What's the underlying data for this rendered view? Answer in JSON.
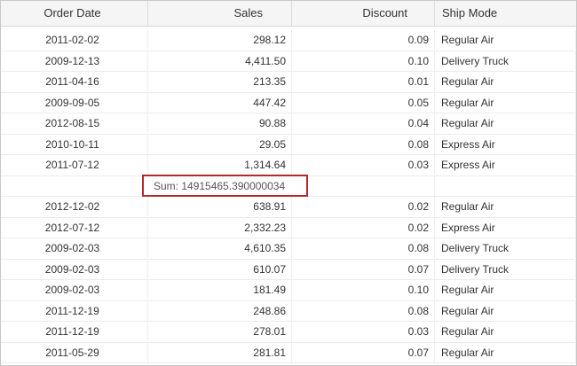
{
  "columns": [
    "Order Date",
    "Sales",
    "Discount",
    "Ship Mode"
  ],
  "rows_top": [
    {
      "date": "2011-02-02",
      "sales": "298.12",
      "discount": "0.09",
      "ship": "Regular Air"
    },
    {
      "date": "2009-12-13",
      "sales": "4,411.50",
      "discount": "0.10",
      "ship": "Delivery Truck"
    },
    {
      "date": "2011-04-16",
      "sales": "213.35",
      "discount": "0.01",
      "ship": "Regular Air"
    },
    {
      "date": "2009-09-05",
      "sales": "447.42",
      "discount": "0.05",
      "ship": "Regular Air"
    },
    {
      "date": "2012-08-15",
      "sales": "90.88",
      "discount": "0.04",
      "ship": "Regular Air"
    },
    {
      "date": "2010-10-11",
      "sales": "29.05",
      "discount": "0.08",
      "ship": "Express Air"
    },
    {
      "date": "2011-07-12",
      "sales": "1,314.64",
      "discount": "0.03",
      "ship": "Express Air"
    }
  ],
  "sum_label": "Sum: 14915465.390000034",
  "rows_bottom": [
    {
      "date": "2012-12-02",
      "sales": "638.91",
      "discount": "0.02",
      "ship": "Regular Air"
    },
    {
      "date": "2012-07-12",
      "sales": "2,332.23",
      "discount": "0.02",
      "ship": "Express Air"
    },
    {
      "date": "2009-02-03",
      "sales": "4,610.35",
      "discount": "0.08",
      "ship": "Delivery Truck"
    },
    {
      "date": "2009-02-03",
      "sales": "610.07",
      "discount": "0.07",
      "ship": "Delivery Truck"
    },
    {
      "date": "2009-02-03",
      "sales": "181.49",
      "discount": "0.10",
      "ship": "Regular Air"
    },
    {
      "date": "2011-12-19",
      "sales": "248.86",
      "discount": "0.08",
      "ship": "Regular Air"
    },
    {
      "date": "2011-12-19",
      "sales": "278.01",
      "discount": "0.03",
      "ship": "Regular Air"
    },
    {
      "date": "2011-05-29",
      "sales": "281.81",
      "discount": "0.07",
      "ship": "Regular Air"
    }
  ],
  "colors": {
    "highlight_border": "#b22a2a",
    "header_bg": "#f5f5f5"
  }
}
